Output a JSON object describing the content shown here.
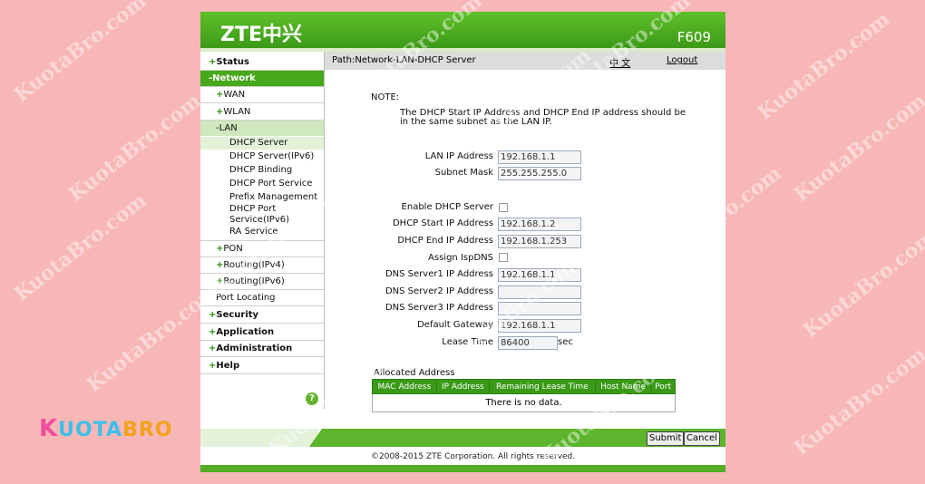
{
  "header": {
    "logo": "ZTE中兴",
    "model": "F609"
  },
  "pathbar": {
    "path": "Path:Network-LAN-DHCP Server",
    "lang": "中 文",
    "logout": "Logout"
  },
  "sidebar": {
    "status": "Status",
    "network": "Network",
    "wan": "WAN",
    "wlan": "WLAN",
    "lan": "LAN",
    "lan_items": [
      "DHCP Server",
      "DHCP Server(IPv6)",
      "DHCP Binding",
      "DHCP Port Service",
      "Prefix Management",
      "DHCP Port",
      "Service(IPv6)",
      "RA Service"
    ],
    "pon": "PON",
    "routing4": "Routing(IPv4)",
    "routing6": "Routing(IPv6)",
    "port_locating": "Port Locating",
    "security": "Security",
    "application": "Application",
    "administration": "Administration",
    "help": "Help",
    "plus": "+",
    "minus": "-",
    "help_icon": "?"
  },
  "note": {
    "title": "NOTE:",
    "line1": "The DHCP Start IP Address and DHCP End IP address should be",
    "line2": "in the same subnet as the LAN IP."
  },
  "form": {
    "lan_ip_label": "LAN IP Address",
    "lan_ip": "192.168.1.1",
    "subnet_label": "Subnet Mask",
    "subnet": "255.255.255.0",
    "enable_dhcp_label": "Enable DHCP Server",
    "start_label": "DHCP Start IP Address",
    "start": "192.168.1.2",
    "end_label": "DHCP End IP Address",
    "end": "192.168.1.253",
    "assign_label": "Assign IspDNS",
    "dns1_label": "DNS Server1 IP Address",
    "dns1": "192.168.1.1",
    "dns2_label": "DNS Server2 IP Address",
    "dns2": "",
    "dns3_label": "DNS Server3 IP Address",
    "dns3": "",
    "gw_label": "Default Gateway",
    "gw": "192.168.1.1",
    "lease_label": "Lease Time",
    "lease": "86400",
    "lease_unit": "sec"
  },
  "allocated": {
    "title": "Allocated Address",
    "columns": [
      "MAC Address",
      "IP Address",
      "Remaining Lease Time",
      "Host Name",
      "Port"
    ],
    "empty": "There is no data."
  },
  "buttons": {
    "submit": "Submit",
    "cancel": "Cancel"
  },
  "footer": {
    "copyright": "©2008-2015 ZTE Corporation. All rights reserved."
  },
  "brand": {
    "k": "K",
    "uota": "UOTA",
    "bro": "BRO"
  },
  "watermark": "KuotaBro.com",
  "colors": {
    "green": "#46a81b",
    "bg": "#f7b7b7"
  }
}
